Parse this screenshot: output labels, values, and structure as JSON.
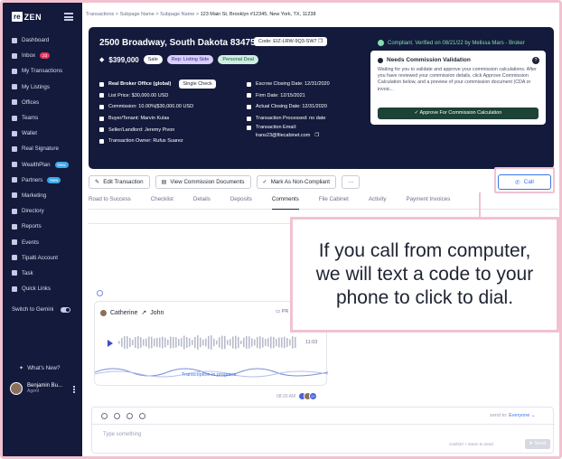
{
  "breadcrumb": {
    "part1": "Transactions",
    "part2": "Subpage Name",
    "part3": "Subpage Name",
    "current": "123 Main St, Brooklyn #12345, New York, TX, 11238"
  },
  "logo": {
    "box": "re",
    "text": "ZEN"
  },
  "sidebar": {
    "items": [
      {
        "label": "Dashboard"
      },
      {
        "label": "Inbox",
        "badge": "23"
      },
      {
        "label": "My Transactions"
      },
      {
        "label": "My Listings"
      },
      {
        "label": "Offices"
      },
      {
        "label": "Teams"
      },
      {
        "label": "Wallet"
      },
      {
        "label": "Real Signature"
      },
      {
        "label": "WealthPlan",
        "badge": "New"
      },
      {
        "label": "Partners",
        "badge": "New"
      },
      {
        "label": "Marketing"
      },
      {
        "label": "Directory"
      },
      {
        "label": "Reports"
      },
      {
        "label": "Events"
      },
      {
        "label": "Tipalti Account"
      },
      {
        "label": "Task"
      },
      {
        "label": "Quick Links"
      },
      {
        "label": "Switch to Gemini"
      }
    ],
    "whats_new": "What's New?",
    "user_name": "Benjamin Bu...",
    "user_role": "Agent"
  },
  "transaction": {
    "address": "2500 Broadway, South Dakota 83475",
    "code": "Code: EIZ-LRW-9Q3-SW7",
    "price": "$399,000",
    "chips": [
      "Sale",
      "Rep: Listing Side",
      "Personal Deal"
    ],
    "verified": "Compliant. Verified on 08/21/22 by Melissa Mars - Broker",
    "col1": [
      {
        "label": "Real Broker Office (global)",
        "bold": true,
        "chip": "Single Check"
      },
      {
        "label": "List Price: $30,000.00 USD"
      },
      {
        "label": "Commission: 10.00%|$30,000.00 USD"
      },
      {
        "label": "Buyer/Tenant: Marvin Kulas"
      },
      {
        "label": "Seller/Landlord: Jeremy Pivon"
      },
      {
        "label": "Transaction Owner: Rufus Suarez"
      }
    ],
    "col2": [
      {
        "label": "Escrow Closing Date: 12/31/2020"
      },
      {
        "label": "Firm Date: 12/15/2021"
      },
      {
        "label": "Actual Closing Date: 12/31/2020"
      },
      {
        "label": "Transaction Processed: no date"
      },
      {
        "label": "Transaction Email:"
      },
      {
        "label": "lrans23@filecabinet.com"
      }
    ],
    "validation": {
      "title": "Needs Commission Validation",
      "body": "Waiting for you to validate and approve your commission calculations. After you have reviewed your commission details, click Approve Commission Calculation below, and a preview of your commission document (CDA or invoic...",
      "button": "Approve For Commission Calculation"
    }
  },
  "actions": {
    "edit": "Edit Transaction",
    "view_docs": "View Commission Documents",
    "mark": "Mark As Non-Compliant",
    "more": "···",
    "call": "Call"
  },
  "tabs": [
    "Road to Success",
    "Checklist",
    "Details",
    "Deposits",
    "Comments",
    "File Cabinet",
    "Activity",
    "Payment Invoices"
  ],
  "message": {
    "from": "Catherine",
    "to": "John",
    "chip": "PR",
    "duration": "11:03",
    "progress": "Transcription in progress",
    "time": "08:20 AM",
    "avatars_more": "2+"
  },
  "composer": {
    "send_to_label": "send to:",
    "send_to_value": "Everyone",
    "placeholder": "Type something",
    "hint": "cmd/ctrl + return to send",
    "send": "Send"
  },
  "tip": "If you call from computer, we will text a code to your phone to click to dial.",
  "colors": {
    "sidebar_bg": "#141a3c",
    "accent": "#3b74e6",
    "highlight": "#f2c1d0",
    "approve": "#1d4236"
  }
}
